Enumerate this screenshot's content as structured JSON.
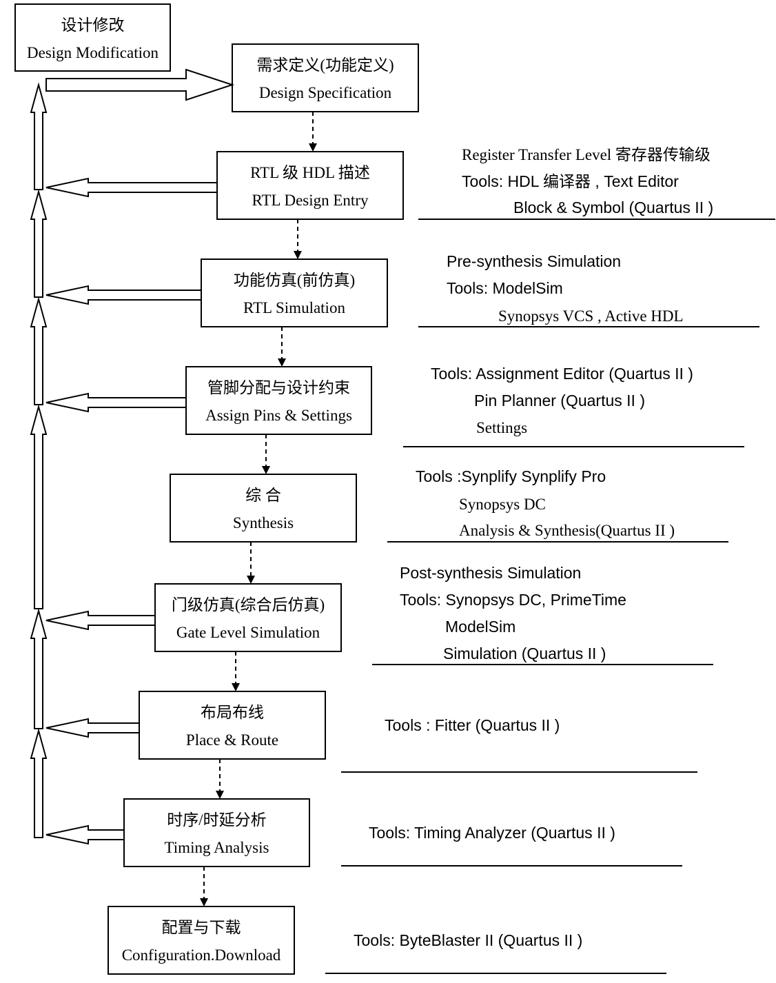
{
  "boxes": [
    {
      "cn": "设计修改",
      "en": "Design Modification"
    },
    {
      "cn": "需求定义(功能定义)",
      "en": "Design Specification"
    },
    {
      "cn": "RTL 级 HDL 描述",
      "en": "RTL Design Entry"
    },
    {
      "cn": "功能仿真(前仿真)",
      "en": "RTL Simulation"
    },
    {
      "cn": "管脚分配与设计约束",
      "en": "Assign Pins & Settings"
    },
    {
      "cn": "综  合",
      "en": "Synthesis"
    },
    {
      "cn": "门级仿真(综合后仿真)",
      "en": "Gate Level Simulation"
    },
    {
      "cn": "布局布线",
      "en": "Place & Route"
    },
    {
      "cn": "时序/时延分析",
      "en": "Timing Analysis"
    },
    {
      "cn": "配置与下载",
      "en": "Configuration.Download"
    }
  ],
  "notes": [
    [
      "Register Transfer Level 寄存器传输级",
      "Tools: HDL  编译器  , Text Editor",
      "Block & Symbol (Quartus II )"
    ],
    [
      "Pre-synthesis Simulation",
      "Tools: ModelSim",
      "Synopsys VCS , Active HDL"
    ],
    [
      "Tools: Assignment Editor (Quartus II )",
      "Pin Planner (Quartus II )",
      "Settings"
    ],
    [
      "Tools :Synplify    Synplify Pro",
      "Synopsys DC",
      "Analysis & Synthesis(Quartus II )"
    ],
    [
      "Post-synthesis Simulation",
      "Tools: Synopsys    DC, PrimeTime",
      "ModelSim",
      "Simulation (Quartus II )"
    ],
    [
      "Tools : Fitter (Quartus II )"
    ],
    [
      "Tools: Timing Analyzer (Quartus II )"
    ],
    [
      "Tools: ByteBlaster II   (Quartus II )"
    ]
  ],
  "colors": {
    "stroke": "#000000",
    "background": "#ffffff"
  }
}
